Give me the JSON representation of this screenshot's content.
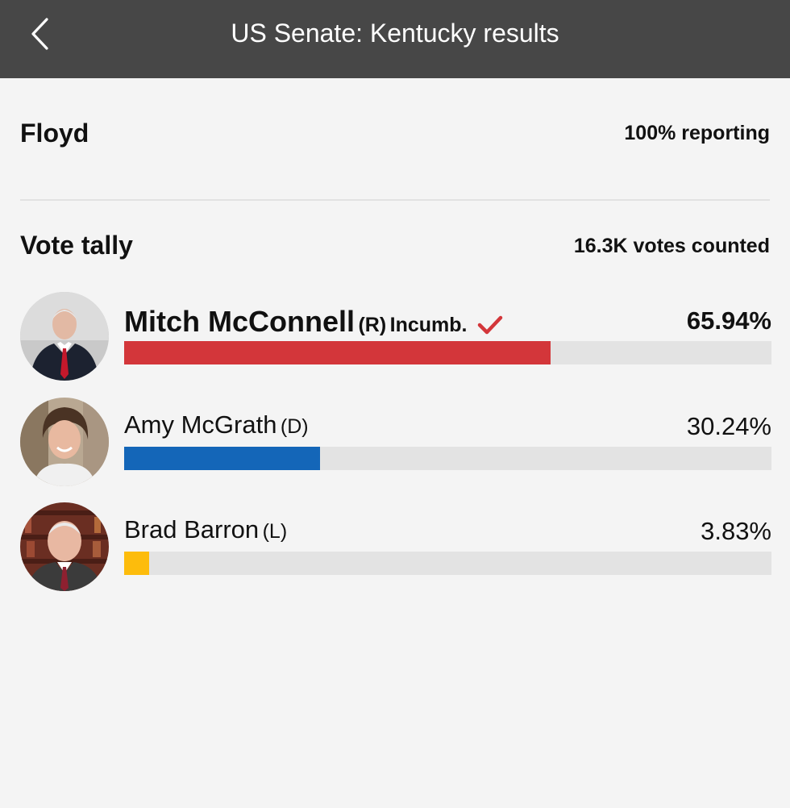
{
  "header": {
    "title": "US Senate: Kentucky results",
    "back_icon": "chevron-left-icon"
  },
  "county": {
    "name": "Floyd",
    "reporting": "100% reporting"
  },
  "tally": {
    "heading": "Vote tally",
    "votes_counted": "16.3K votes counted"
  },
  "candidates": [
    {
      "name": "Mitch McConnell",
      "party": "(R)",
      "incumbent": "Incumb.",
      "winner": true,
      "percent_label": "65.94%",
      "share": 0.6594,
      "color": "#d3363a"
    },
    {
      "name": "Amy McGrath",
      "party": "(D)",
      "incumbent": "",
      "winner": false,
      "percent_label": "30.24%",
      "share": 0.3024,
      "color": "#1466b8"
    },
    {
      "name": "Brad Barron",
      "party": "(L)",
      "incumbent": "",
      "winner": false,
      "percent_label": "3.83%",
      "share": 0.0383,
      "color": "#fdbc0c"
    }
  ],
  "colors": {
    "topbar": "#474747",
    "background": "#f4f4f4",
    "bar_track": "#e3e3e3",
    "winner_check": "#d3363a"
  }
}
